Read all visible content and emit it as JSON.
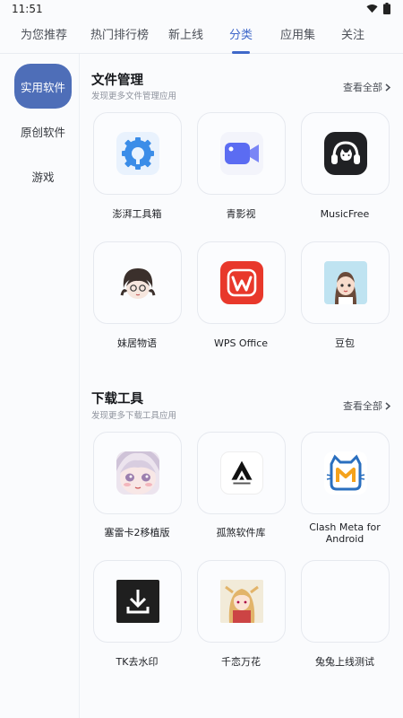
{
  "status": {
    "time": "11:51"
  },
  "tabs": [
    {
      "label": "为您推荐"
    },
    {
      "label": "热门排行榜"
    },
    {
      "label": "新上线"
    },
    {
      "label": "分类"
    },
    {
      "label": "应用集"
    },
    {
      "label": "关注"
    }
  ],
  "sidebar": {
    "items": [
      {
        "label": "实用软件"
      },
      {
        "label": "原创软件"
      },
      {
        "label": "游戏"
      }
    ]
  },
  "sections": [
    {
      "title": "文件管理",
      "subtitle": "发现更多文件管理应用",
      "view_all": "查看全部",
      "apps": [
        {
          "name": "澎湃工具箱",
          "icon": "gear-icon"
        },
        {
          "name": "青影视",
          "icon": "video-camera-icon"
        },
        {
          "name": "MusicFree",
          "icon": "headphones-cat-icon"
        },
        {
          "name": "妹居物语",
          "icon": "anime-girl-icon"
        },
        {
          "name": "WPS Office",
          "icon": "wps-logo-icon"
        },
        {
          "name": "豆包",
          "icon": "doubao-avatar-icon"
        }
      ]
    },
    {
      "title": "下载工具",
      "subtitle": "发现更多下载工具应用",
      "view_all": "查看全部",
      "apps": [
        {
          "name": "塞雷卡2移植版",
          "icon": "anime-face-icon"
        },
        {
          "name": "孤煞软件库",
          "icon": "triangle-logo-icon"
        },
        {
          "name": "Clash Meta for Android",
          "icon": "clash-cat-icon"
        },
        {
          "name": "TK去水印",
          "icon": "download-icon"
        },
        {
          "name": "千恋万花",
          "icon": "anime-poster-icon"
        },
        {
          "name": "兔兔上线测试",
          "icon": "blank-icon"
        }
      ]
    }
  ],
  "colors": {
    "accent": "#3f68c9",
    "sidebar_active": "#4e6eb8"
  }
}
